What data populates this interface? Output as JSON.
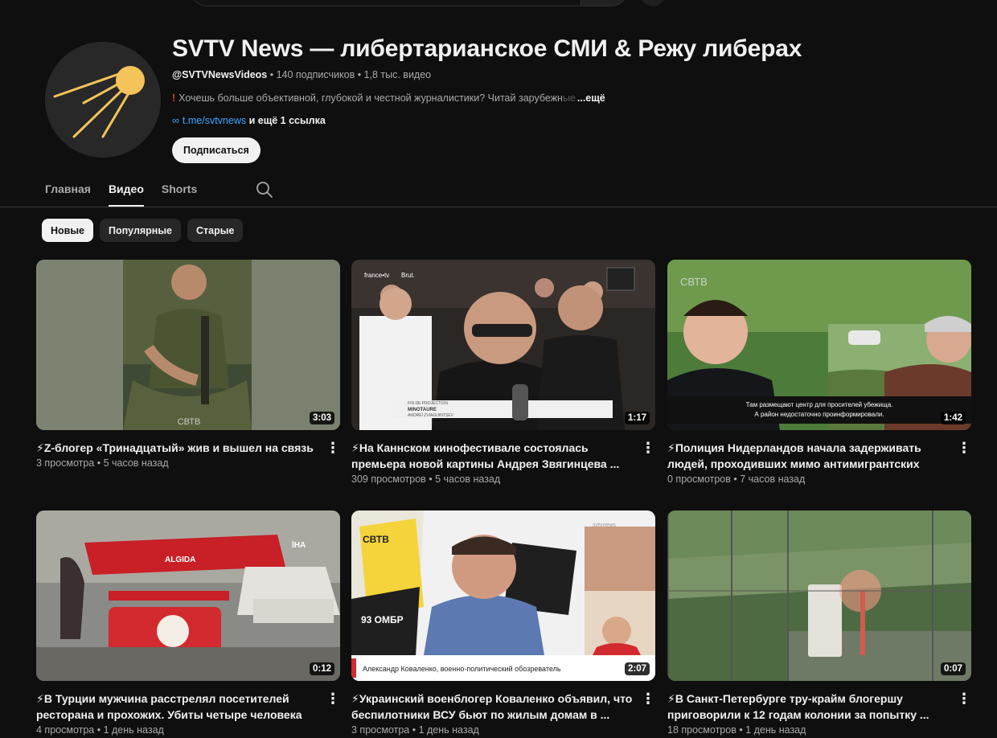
{
  "channel": {
    "title": "SVTV News — либертарианское СМИ & Режу либерах",
    "handle": "@SVTVNewsVideos",
    "subscribers": "140 подписчиков",
    "video_count": "1,8 тыс. видео",
    "separator": " • ",
    "description_excl": "!",
    "description": "Хочешь больше объективной, глубокой и честной журналистики? Читай зарубежн",
    "description_fade": "ые",
    "more_label": "...ещё",
    "link_icon": "link-icon",
    "link": "t.me/svtvnews",
    "more_links": " и ещё 1 ссылка",
    "subscribe_label": "Подписаться"
  },
  "tabs": [
    {
      "label": "Главная",
      "active": false
    },
    {
      "label": "Видео",
      "active": true
    },
    {
      "label": "Shorts",
      "active": false
    }
  ],
  "chips": [
    {
      "label": "Новые",
      "active": true
    },
    {
      "label": "Популярные",
      "active": false
    },
    {
      "label": "Старые",
      "active": false
    }
  ],
  "videos": [
    {
      "title": "⚡Z-блогер «Тринадцатый» жив и вышел на связь",
      "views": "3 просмотра",
      "age": "5 часов назад",
      "duration": "3:03"
    },
    {
      "title": "⚡На Каннском кинофестивале состоялась премьера новой картины Андрея Звягинцева ...",
      "views": "309 просмотров",
      "age": "5 часов назад",
      "duration": "1:17"
    },
    {
      "title": "⚡Полиция Нидерландов начала задерживать людей, проходивших мимо антимигрантских акций",
      "views": "0 просмотров",
      "age": "7 часов назад",
      "duration": "1:42"
    },
    {
      "title": "⚡В Турции мужчина расстрелял посетителей ресторана и прохожих. Убиты четыре человека",
      "views": "4 просмотра",
      "age": "1 день назад",
      "duration": "0:12"
    },
    {
      "title": "⚡Украинский военблогер Коваленко объявил, что беспилотники ВСУ бьют по жилым домам в ...",
      "views": "3 просмотра",
      "age": "1 день назад",
      "duration": "2:07"
    },
    {
      "title": "⚡В Санкт-Петербурге тру-крайм блогершу приговорили к 12 годам колонии за попытку ...",
      "views": "18 просмотров",
      "age": "1 день назад",
      "duration": "0:07"
    }
  ],
  "thumb_text": {
    "v1_watermark": "СВТВ",
    "v2_tag1": "france•tv",
    "v2_tag2": "Brut.",
    "v2_caption_top": "FIN DE PROJECTION",
    "v2_caption_mid": "MINOTAURE",
    "v2_caption_bot": "ANDREÏ ZVIAGUINTSEV",
    "v3_watermark": "СВТВ",
    "v3_sub1": "Там размещают центр для просителей убежища.",
    "v3_sub2": "А район недостаточно проинформировали.",
    "v4_brand": "ALGIDA",
    "v4_tag": "İHA",
    "v5_logo": "СВТВ",
    "v5_flag": "93 ОМБР",
    "v5_caption": "Александр Коваленко, военно-политический обозреватель",
    "v5_wm": "svtvnews"
  }
}
